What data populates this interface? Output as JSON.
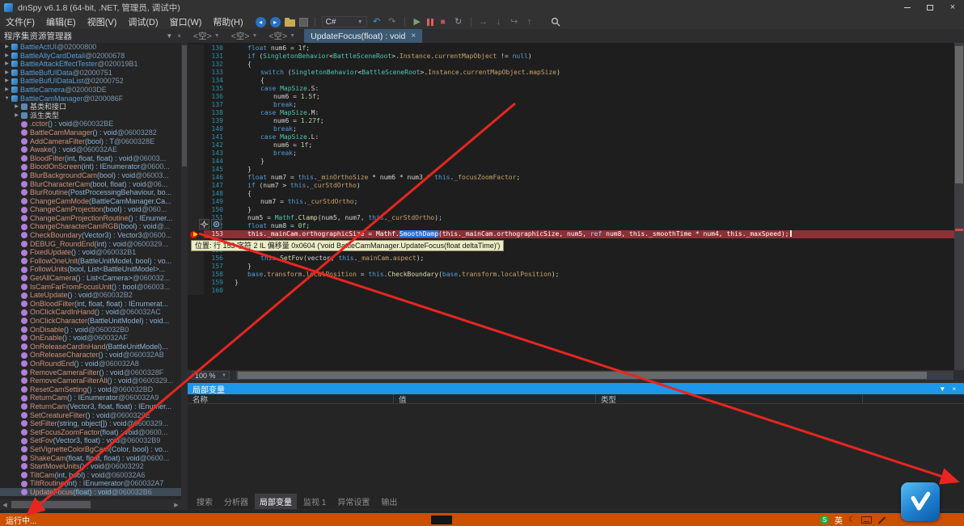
{
  "window": {
    "title": "dnSpy v6.1.8 (64-bit, .NET, 管理员, 调试中)"
  },
  "menu": {
    "items": [
      "文件(F)",
      "编辑(E)",
      "视图(V)",
      "调试(D)",
      "窗口(W)",
      "帮助(H)"
    ]
  },
  "toolbar": {
    "language": "C#"
  },
  "assembly_explorer": {
    "title": "程序集资源管理器",
    "items": [
      {
        "ind": 0,
        "exp": "c",
        "icon": "cls",
        "name": "BattleActUI",
        "sig": "",
        "addr": "@02000800"
      },
      {
        "ind": 0,
        "exp": "c",
        "icon": "cls",
        "name": "BattleAllyCardDetail",
        "sig": "",
        "addr": "@02000678"
      },
      {
        "ind": 0,
        "exp": "c",
        "icon": "cls",
        "name": "BattleAttackEffectTester",
        "sig": "",
        "addr": "@020019B1"
      },
      {
        "ind": 0,
        "exp": "c",
        "icon": "cls",
        "name": "BattleBufUIData",
        "sig": "",
        "addr": "@02000751"
      },
      {
        "ind": 0,
        "exp": "c",
        "icon": "cls",
        "name": "BattleBufUIDataList",
        "sig": "",
        "addr": "@02000752"
      },
      {
        "ind": 0,
        "exp": "c",
        "icon": "cls",
        "name": "BattleCamera",
        "sig": "",
        "addr": "@020003DE"
      },
      {
        "ind": 0,
        "exp": "e",
        "icon": "cls",
        "name": "BattleCamManager",
        "sig": "",
        "addr": "@0200086F"
      },
      {
        "ind": 1,
        "exp": "c",
        "icon": "fold",
        "name": "基类和接口",
        "sig": "",
        "addr": ""
      },
      {
        "ind": 1,
        "exp": "c",
        "icon": "fold",
        "name": "派生类型",
        "sig": "",
        "addr": ""
      },
      {
        "ind": 1,
        "icon": "mth",
        "name": ".cctor",
        "sig": "() : void",
        "addr": "@060032BE"
      },
      {
        "ind": 1,
        "icon": "mth",
        "name": "BattleCamManager",
        "sig": "() : void",
        "addr": "@06003282"
      },
      {
        "ind": 1,
        "icon": "mth",
        "name": "AddCameraFilter",
        "sig": "(bool) : T",
        "addr": "@0600328E"
      },
      {
        "ind": 1,
        "icon": "mth",
        "name": "Awake",
        "sig": "() : void",
        "addr": "@060032AE"
      },
      {
        "ind": 1,
        "icon": "mth",
        "name": "BloodFilter",
        "sig": "(int, float, float) : void",
        "addr": "@06003..."
      },
      {
        "ind": 1,
        "icon": "mth",
        "name": "BloodOnScreen",
        "sig": "(int) : IEnumerator",
        "addr": "@0600..."
      },
      {
        "ind": 1,
        "icon": "mth",
        "name": "BlurBackgroundCam",
        "sig": "(bool) : void",
        "addr": "@06003..."
      },
      {
        "ind": 1,
        "icon": "mth",
        "name": "BlurCharacterCam",
        "sig": "(bool, float) : void",
        "addr": "@06..."
      },
      {
        "ind": 1,
        "icon": "mth",
        "name": "BlurRoutine",
        "sig": "(PostProcessingBehaviour, bo...",
        "addr": ""
      },
      {
        "ind": 1,
        "icon": "mth",
        "name": "ChangeCamMode",
        "sig": "(BattleCamManager.Ca...",
        "addr": ""
      },
      {
        "ind": 1,
        "icon": "mth",
        "name": "ChangeCamProjection",
        "sig": "(bool) : void",
        "addr": "@060..."
      },
      {
        "ind": 1,
        "icon": "mth",
        "name": "ChangeCamProjectionRoutine",
        "sig": "() : IEnumer...",
        "addr": ""
      },
      {
        "ind": 1,
        "icon": "mth",
        "name": "ChangeCharacterCamRGB",
        "sig": "(bool) : void",
        "addr": "@..."
      },
      {
        "ind": 1,
        "icon": "mth",
        "name": "CheckBoundary",
        "sig": "(Vector3) : Vector3",
        "addr": "@0600..."
      },
      {
        "ind": 1,
        "icon": "mth",
        "name": "DEBUG_RoundEnd",
        "sig": "(int) : void",
        "addr": "@0600329..."
      },
      {
        "ind": 1,
        "icon": "mth",
        "name": "FixedUpdate",
        "sig": "() : void",
        "addr": "@060032B1"
      },
      {
        "ind": 1,
        "icon": "mth",
        "name": "FollowOneUnit",
        "sig": "(BattleUnitModel, bool) : vo...",
        "addr": ""
      },
      {
        "ind": 1,
        "icon": "mth",
        "name": "FollowUnits",
        "sig": "(bool, List<BattleUnitModel>...",
        "addr": ""
      },
      {
        "ind": 1,
        "icon": "mth",
        "name": "GetAllCamera",
        "sig": "() : List<Camera>",
        "addr": "@060032..."
      },
      {
        "ind": 1,
        "icon": "mth",
        "name": "IsCamFarFromFocusUnit",
        "sig": "() : bool",
        "addr": "@06003..."
      },
      {
        "ind": 1,
        "icon": "mth",
        "name": "LateUpdate",
        "sig": "() : void",
        "addr": "@060032B2"
      },
      {
        "ind": 1,
        "icon": "mth",
        "name": "OnBloodFilter",
        "sig": "(int, float, float) : IEnumerat...",
        "addr": ""
      },
      {
        "ind": 1,
        "icon": "mth",
        "name": "OnClickCardInHand",
        "sig": "() : void",
        "addr": "@060032AC"
      },
      {
        "ind": 1,
        "icon": "mth",
        "name": "OnClickCharacter",
        "sig": "(BattleUnitModel) : void...",
        "addr": ""
      },
      {
        "ind": 1,
        "icon": "mth",
        "name": "OnDisable",
        "sig": "() : void",
        "addr": "@060032B0"
      },
      {
        "ind": 1,
        "icon": "mth",
        "name": "OnEnable",
        "sig": "() : void",
        "addr": "@060032AF"
      },
      {
        "ind": 1,
        "icon": "mth",
        "name": "OnReleaseCardInHand",
        "sig": "(BattleUnitModel)...",
        "addr": ""
      },
      {
        "ind": 1,
        "icon": "mth",
        "name": "OnReleaseCharacter",
        "sig": "() : void",
        "addr": "@060032AB"
      },
      {
        "ind": 1,
        "icon": "mth",
        "name": "OnRoundEnd",
        "sig": "() : void",
        "addr": "@060032A8"
      },
      {
        "ind": 1,
        "icon": "mth",
        "name": "RemoveCameraFilter",
        "sig": "() : void",
        "addr": "@0600328F"
      },
      {
        "ind": 1,
        "icon": "mth",
        "name": "RemoveCameraFilterAll",
        "sig": "() : void",
        "addr": "@0600329..."
      },
      {
        "ind": 1,
        "icon": "mth",
        "name": "ResetCamSetting",
        "sig": "() : void",
        "addr": "@060032BD"
      },
      {
        "ind": 1,
        "icon": "mth",
        "name": "ReturnCam",
        "sig": "() : IEnumerator",
        "addr": "@060032A9"
      },
      {
        "ind": 1,
        "icon": "mth",
        "name": "ReturnCam",
        "sig": "(Vector3, float, float) : IEnumer...",
        "addr": ""
      },
      {
        "ind": 1,
        "icon": "mth",
        "name": "SetCreatureFilter",
        "sig": "() : void",
        "addr": "@0600329E"
      },
      {
        "ind": 1,
        "icon": "mth",
        "name": "SetFilter",
        "sig": "(string, object[]) : void",
        "addr": "@0600329..."
      },
      {
        "ind": 1,
        "icon": "mth",
        "name": "SetFocusZoomFactor",
        "sig": "(float) : void",
        "addr": "@0600..."
      },
      {
        "ind": 1,
        "icon": "mth",
        "name": "SetFov",
        "sig": "(Vector3, float) : void",
        "addr": "@060032B9"
      },
      {
        "ind": 1,
        "icon": "mth",
        "name": "SetVignetteColorBgCam",
        "sig": "(Color, bool) : vo...",
        "addr": ""
      },
      {
        "ind": 1,
        "icon": "mth",
        "name": "ShakeCam",
        "sig": "(float, float, float) : void",
        "addr": "@0600..."
      },
      {
        "ind": 1,
        "icon": "mth",
        "name": "StartMoveUnits",
        "sig": "() : void",
        "addr": "@06003292"
      },
      {
        "ind": 1,
        "icon": "mth",
        "name": "TiltCam",
        "sig": "(int, bool) : void",
        "addr": "@060032A6"
      },
      {
        "ind": 1,
        "icon": "mth",
        "name": "TiltRoutine",
        "sig": "(int) : IEnumerator",
        "addr": "@060032A7"
      },
      {
        "ind": 1,
        "icon": "mth",
        "name": "UpdateFocus",
        "sig": "(float) : void",
        "addr": "@060032B6",
        "sel": true
      }
    ]
  },
  "editor_tabs": {
    "empty_tabs": [
      "<空>",
      "<空>",
      "<空>"
    ],
    "active_tab": "UpdateFocus(float) : void"
  },
  "editor": {
    "zoom": "100 %",
    "breakpoint_line": 153,
    "tooltip": "位置: 行 153 字符 2 IL 偏移量 0x0604 ('void BattleCamManager.UpdateFocus(float deltaTime)')",
    "lines": [
      {
        "n": 130,
        "i": 1,
        "s": [
          [
            "k",
            "float"
          ],
          [
            "p",
            " num6 = "
          ],
          [
            "n",
            "1f"
          ],
          [
            "p",
            ";"
          ]
        ]
      },
      {
        "n": 131,
        "i": 1,
        "s": [
          [
            "k",
            "if"
          ],
          [
            "p",
            " ("
          ],
          [
            "t",
            "SingletonBehavior"
          ],
          [
            "p",
            "<"
          ],
          [
            "t",
            "BattleSceneRoot"
          ],
          [
            "p",
            ">."
          ],
          [
            "f",
            "Instance"
          ],
          [
            "p",
            "."
          ],
          [
            "f",
            "currentMapObject"
          ],
          [
            "p",
            " != "
          ],
          [
            "k",
            "null"
          ],
          [
            "p",
            ")"
          ]
        ]
      },
      {
        "n": 132,
        "i": 1,
        "s": [
          [
            "p",
            "{"
          ]
        ]
      },
      {
        "n": 133,
        "i": 2,
        "s": [
          [
            "k",
            "switch"
          ],
          [
            "p",
            " ("
          ],
          [
            "t",
            "SingletonBehavior"
          ],
          [
            "p",
            "<"
          ],
          [
            "t",
            "BattleSceneRoot"
          ],
          [
            "p",
            ">."
          ],
          [
            "f",
            "Instance"
          ],
          [
            "p",
            "."
          ],
          [
            "f",
            "currentMapObject"
          ],
          [
            "p",
            "."
          ],
          [
            "f",
            "mapSize"
          ],
          [
            "p",
            ")"
          ]
        ]
      },
      {
        "n": 134,
        "i": 2,
        "s": [
          [
            "p",
            "{"
          ]
        ]
      },
      {
        "n": 135,
        "i": 2,
        "s": [
          [
            "k",
            "case"
          ],
          [
            "p",
            " "
          ],
          [
            "t",
            "MapSize"
          ],
          [
            "p",
            ".S:"
          ]
        ]
      },
      {
        "n": 136,
        "i": 3,
        "s": [
          [
            "p",
            "num6 = "
          ],
          [
            "n",
            "1.5f"
          ],
          [
            "p",
            ";"
          ]
        ]
      },
      {
        "n": 137,
        "i": 3,
        "s": [
          [
            "k",
            "break"
          ],
          [
            "p",
            ";"
          ]
        ]
      },
      {
        "n": 138,
        "i": 2,
        "s": [
          [
            "k",
            "case"
          ],
          [
            "p",
            " "
          ],
          [
            "t",
            "MapSize"
          ],
          [
            "p",
            ".M:"
          ]
        ]
      },
      {
        "n": 139,
        "i": 3,
        "s": [
          [
            "p",
            "num6 = "
          ],
          [
            "n",
            "1.27f"
          ],
          [
            "p",
            ";"
          ]
        ]
      },
      {
        "n": 140,
        "i": 3,
        "s": [
          [
            "k",
            "break"
          ],
          [
            "p",
            ";"
          ]
        ]
      },
      {
        "n": 141,
        "i": 2,
        "s": [
          [
            "k",
            "case"
          ],
          [
            "p",
            " "
          ],
          [
            "t",
            "MapSize"
          ],
          [
            "p",
            ".L:"
          ]
        ]
      },
      {
        "n": 142,
        "i": 3,
        "s": [
          [
            "p",
            "num6 = "
          ],
          [
            "n",
            "1f"
          ],
          [
            "p",
            ";"
          ]
        ]
      },
      {
        "n": 143,
        "i": 3,
        "s": [
          [
            "k",
            "break"
          ],
          [
            "p",
            ";"
          ]
        ]
      },
      {
        "n": 144,
        "i": 2,
        "s": [
          [
            "p",
            "}"
          ]
        ]
      },
      {
        "n": 145,
        "i": 1,
        "s": [
          [
            "p",
            "}"
          ]
        ]
      },
      {
        "n": 146,
        "i": 1,
        "s": [
          [
            "k",
            "float"
          ],
          [
            "p",
            " num7 = "
          ],
          [
            "k",
            "this"
          ],
          [
            "p",
            "."
          ],
          [
            "f",
            "_minOrthoSize"
          ],
          [
            "p",
            " * num6 * num3 * "
          ],
          [
            "k",
            "this"
          ],
          [
            "p",
            "."
          ],
          [
            "f",
            "_focusZoomFactor"
          ],
          [
            "p",
            ";"
          ]
        ]
      },
      {
        "n": 147,
        "i": 1,
        "s": [
          [
            "k",
            "if"
          ],
          [
            "p",
            " (num7 > "
          ],
          [
            "k",
            "this"
          ],
          [
            "p",
            "."
          ],
          [
            "f",
            "_curStdOrtho"
          ],
          [
            "p",
            ")"
          ]
        ]
      },
      {
        "n": 148,
        "i": 1,
        "s": [
          [
            "p",
            "{"
          ]
        ]
      },
      {
        "n": 149,
        "i": 2,
        "s": [
          [
            "p",
            "num7 = "
          ],
          [
            "k",
            "this"
          ],
          [
            "p",
            "."
          ],
          [
            "f",
            "_curStdOrtho"
          ],
          [
            "p",
            ";"
          ]
        ]
      },
      {
        "n": 150,
        "i": 1,
        "s": [
          [
            "p",
            "}"
          ]
        ]
      },
      {
        "n": 151,
        "i": 1,
        "s": [
          [
            "p",
            "num5 = "
          ],
          [
            "t",
            "Mathf"
          ],
          [
            "p",
            "."
          ],
          [
            "m",
            "Clamp"
          ],
          [
            "p",
            "(num5, num7, "
          ],
          [
            "k",
            "this"
          ],
          [
            "p",
            "."
          ],
          [
            "f",
            "_curStdOrtho"
          ],
          [
            "p",
            ");"
          ]
        ]
      },
      {
        "n": 152,
        "i": 1,
        "s": [
          [
            "k",
            "float"
          ],
          [
            "p",
            " num8 = "
          ],
          [
            "n",
            "0f"
          ],
          [
            "p",
            ";"
          ]
        ]
      },
      {
        "n": 153,
        "i": 1,
        "s": [
          [
            "w",
            "this._mainCam.orthographicSize = Mathf."
          ],
          [
            "sel",
            "SmoothDamp"
          ],
          [
            "w",
            "(this._mainCam.orthographicSize, num5, "
          ],
          [
            "kw",
            "ref"
          ],
          [
            "w",
            " num8, this._smoothTime * num4, this._maxSpeed);"
          ]
        ]
      },
      {
        "n": 154,
        "i": 1,
        "s": []
      },
      {
        "n": 155,
        "i": 1,
        "s": []
      },
      {
        "n": 156,
        "i": 2,
        "s": [
          [
            "k",
            "this"
          ],
          [
            "p",
            "."
          ],
          [
            "m",
            "SetFov"
          ],
          [
            "p",
            "(vector, "
          ],
          [
            "k",
            "this"
          ],
          [
            "p",
            "."
          ],
          [
            "f",
            "_mainCam"
          ],
          [
            "p",
            "."
          ],
          [
            "f",
            "aspect"
          ],
          [
            "p",
            ");"
          ]
        ]
      },
      {
        "n": 157,
        "i": 1,
        "s": [
          [
            "p",
            "}"
          ]
        ]
      },
      {
        "n": 158,
        "i": 1,
        "s": [
          [
            "k",
            "base"
          ],
          [
            "p",
            "."
          ],
          [
            "f",
            "transform"
          ],
          [
            "p",
            "."
          ],
          [
            "f",
            "localPosition"
          ],
          [
            "p",
            " = "
          ],
          [
            "k",
            "this"
          ],
          [
            "p",
            "."
          ],
          [
            "m",
            "CheckBoundary"
          ],
          [
            "p",
            "("
          ],
          [
            "k",
            "base"
          ],
          [
            "p",
            "."
          ],
          [
            "f",
            "transform"
          ],
          [
            "p",
            "."
          ],
          [
            "f",
            "localPosition"
          ],
          [
            "p",
            ");"
          ]
        ]
      },
      {
        "n": 159,
        "i": 0,
        "s": [
          [
            "p",
            "}"
          ]
        ]
      },
      {
        "n": 160,
        "i": 0,
        "s": []
      }
    ]
  },
  "locals_panel": {
    "title": "局部变量",
    "columns": [
      "名称",
      "值",
      "类型"
    ]
  },
  "bottom_tabs": {
    "items": [
      "搜索",
      "分析器",
      "局部变量",
      "监视 1",
      "异常设置",
      "输出"
    ],
    "active": "局部变量"
  },
  "status_bar": {
    "text": "运行中..."
  },
  "tray": {
    "ime_badge": "S",
    "ime_lang": "英"
  },
  "colors": {
    "accent_blue": "#1c97ea",
    "debug_orange": "#ca5100",
    "breakpoint_red": "#8a3136",
    "annotation_red": "#e8261f"
  }
}
